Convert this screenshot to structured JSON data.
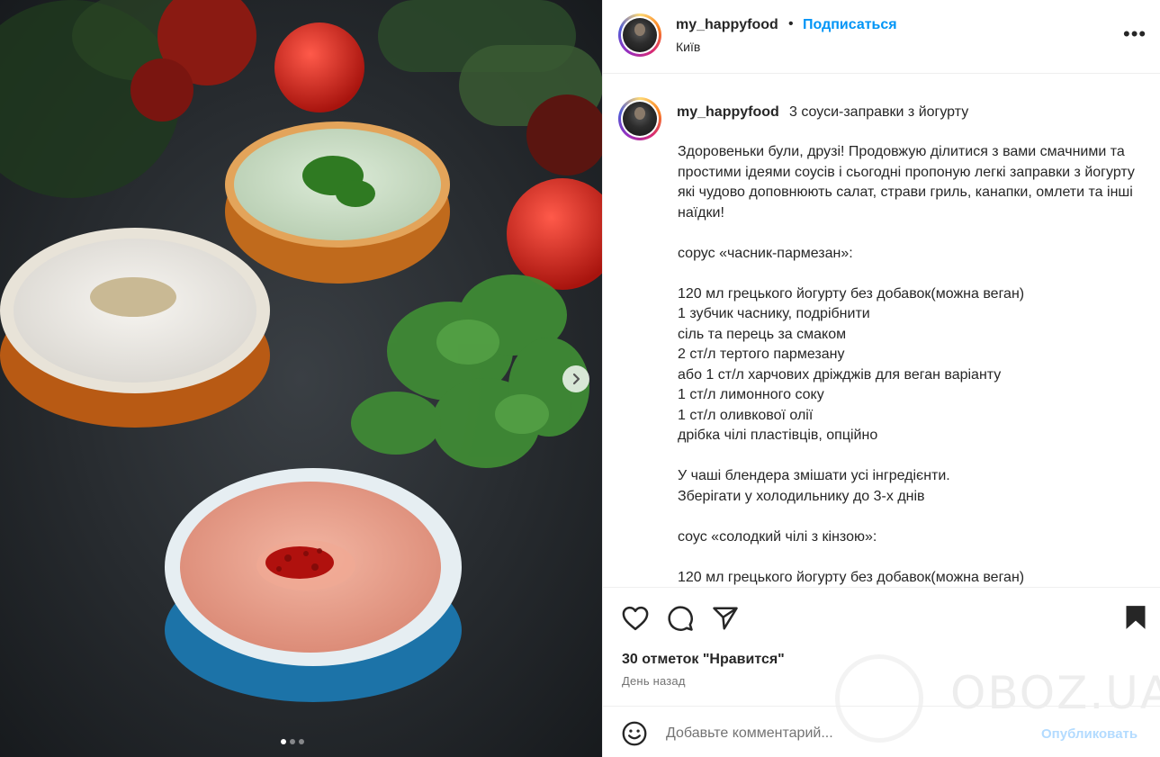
{
  "post": {
    "username": "my_happyfood",
    "bullet": "•",
    "follow_label": "Подписаться",
    "location": "Київ",
    "more_label": "•••"
  },
  "caption": {
    "username": "my_happyfood",
    "title": "3 соуси-заправки з йогурту",
    "body": "Здоровеньки були, друзі! Продовжую ділитися з вами смачними та простими ідеями соусів і сьогодні пропоную легкі заправки з йогурту які чудово доповнюють салат, страви гриль, канапки, омлети та інші наїдки!\n\nсорус «часник-пармезан»:\n\n120 мл грецького йогурту без добавок(можна веган)\n1 зубчик часнику, подрібнити\nсіль та перець за смаком\n2 ст/л тертого пармезану\nабо 1 ст/л харчових дріжджів для веган варіанту\n1 ст/л лимонного соку\n1 ст/л оливкової олії\nдрібка чілі пластівців, опційно\n\nУ чаші блендера змішати усі інгредієнти.\nЗберігати у холодильнику до 3-х днів\n\nсоус «солодкий чілі з кінзою»:\n\n120 мл грецького йогурту без добавок(можна веган)"
  },
  "engagement": {
    "likes_text": "30 отметок \"Нравится\"",
    "time_text": "День назад"
  },
  "comment": {
    "placeholder": "Добавьте комментарий...",
    "publish_label": "Опубликовать"
  },
  "watermark": {
    "text": "OBOZ.UA"
  },
  "carousel": {
    "active_index": 1,
    "total": 3
  },
  "icons": {
    "heart": "heart-icon",
    "comment": "comment-icon",
    "share": "share-icon",
    "save": "bookmark-icon",
    "emoji": "emoji-icon",
    "next": "chevron-right-icon",
    "more": "more-options-icon"
  },
  "colors": {
    "link": "#0095f6",
    "publish_disabled": "#b3dbff",
    "text": "#262626",
    "muted": "#737373"
  }
}
